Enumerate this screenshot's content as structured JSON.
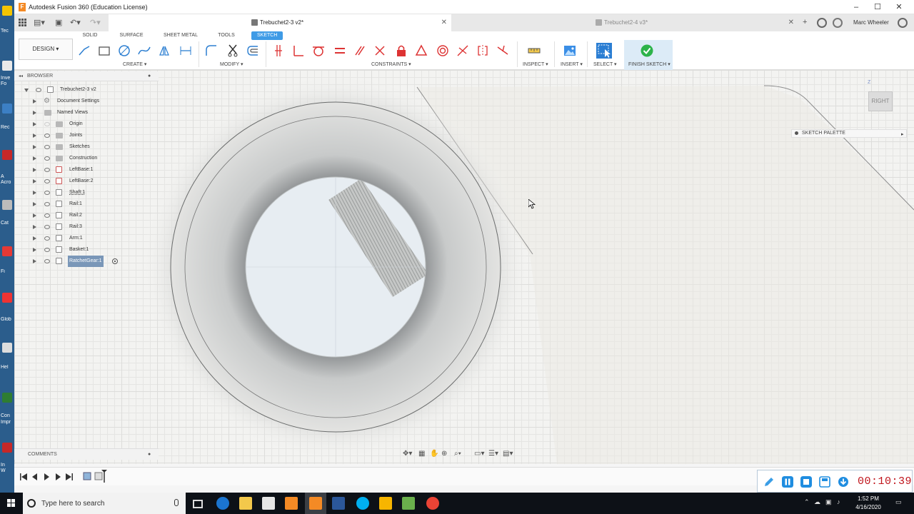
{
  "window": {
    "title": "Autodesk Fusion 360 (Education License)"
  },
  "tabs": [
    {
      "label": "Trebuchet2-3 v2*",
      "active": true
    },
    {
      "label": "Trebuchet2-4 v3*",
      "active": false
    }
  ],
  "user": {
    "name": "Marc Wheeler"
  },
  "ribbon": {
    "workspace": "DESIGN ▾",
    "tabs": [
      "SOLID",
      "SURFACE",
      "SHEET METAL",
      "TOOLS",
      "SKETCH"
    ],
    "active_tab": "SKETCH",
    "groups": {
      "create": "CREATE ▾",
      "modify": "MODIFY ▾",
      "constraints": "CONSTRAINTS ▾",
      "inspect": "INSPECT ▾",
      "insert": "INSERT ▾",
      "select": "SELECT ▾",
      "finish": "FINISH SKETCH ▾"
    }
  },
  "browser": {
    "header": "BROWSER",
    "root": "Trebuchet2-3 v2",
    "items": [
      {
        "label": "Document Settings"
      },
      {
        "label": "Named Views"
      },
      {
        "label": "Origin"
      },
      {
        "label": "Joints"
      },
      {
        "label": "Sketches"
      },
      {
        "label": "Construction"
      },
      {
        "label": "LeftBase:1"
      },
      {
        "label": "LeftBase:2"
      },
      {
        "label": "Shaft:1"
      },
      {
        "label": "Rail:1"
      },
      {
        "label": "Rail:2"
      },
      {
        "label": "Rail:3"
      },
      {
        "label": "Arm:1"
      },
      {
        "label": "Basket:1"
      },
      {
        "label": "RatchetGear:1",
        "selected": true
      }
    ]
  },
  "viewcube": {
    "face": "RIGHT",
    "axis": "Z"
  },
  "sketch_palette": {
    "label": "SKETCH PALETTE"
  },
  "comments": {
    "label": "COMMENTS"
  },
  "recorder": {
    "time": "00:10:39"
  },
  "taskbar": {
    "search_placeholder": "Type here to search",
    "time": "1:52 PM",
    "date": "4/16/2020"
  },
  "desktop_labels": [
    "Tec",
    "Inve",
    "Fo",
    "Rec",
    "A",
    "Acro",
    "Cat",
    "Fi",
    "Glob",
    "Hel",
    "Con",
    "Impr",
    "In",
    "W"
  ],
  "colors": {
    "accent": "#3f9be6",
    "finish_check": "#2db34a",
    "recorder_time": "#c0141b",
    "selection": "#7a97b8"
  }
}
